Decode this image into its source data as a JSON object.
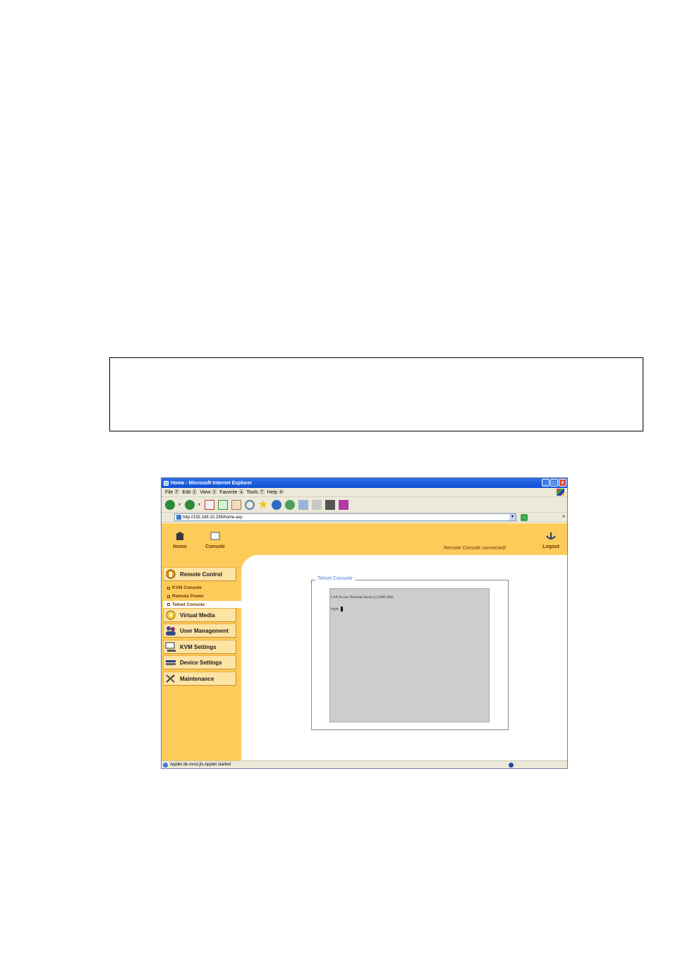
{
  "window": {
    "title": "Home - Microsoft Internet Explorer",
    "controls": [
      "_",
      "□",
      "×"
    ]
  },
  "menu": {
    "items": [
      "File Ⓕ",
      "Edit Ⓔ",
      "View Ⓥ",
      "Favorite Ⓐ",
      "Tools Ⓣ",
      "Help Ⓗ"
    ]
  },
  "toolbar": {
    "icons": [
      "back-icon",
      "forward-icon",
      "stop-icon",
      "refresh-icon",
      "home-icon",
      "search-icon",
      "favorites-icon",
      "media-icon",
      "history-icon",
      "mail-icon",
      "print-icon",
      "edit-icon",
      "messenger-icon"
    ]
  },
  "address": {
    "url": "http://192.168.10.235/home.asp",
    "go_label": "→",
    "more": "»"
  },
  "header": {
    "home_label": "Home",
    "console_label": "Console",
    "status": "Remote Console connected!",
    "logout_label": "Logout"
  },
  "sidebar": {
    "remote_control": "Remote Control",
    "sub_items": [
      "KVM Console",
      "Remote Power",
      "Telnet Console"
    ],
    "virtual_media": "Virtual Media",
    "user_management": "User Management",
    "kvm_settings": "KVM Settings",
    "device_settings": "Device Settings",
    "maintenance": "Maintenance"
  },
  "console": {
    "legend": "Telnet Console",
    "line1": "LAN Access Terminal Server (c) 2000-2002",
    "line2": "login:"
  },
  "statusbar": {
    "text": "Applet de.ovsd.jts.Applet started"
  },
  "colors": {
    "app_header": "#fdcb5a",
    "titlebar": "#0f4fd6",
    "terminal_bg": "#cdcdcd"
  }
}
